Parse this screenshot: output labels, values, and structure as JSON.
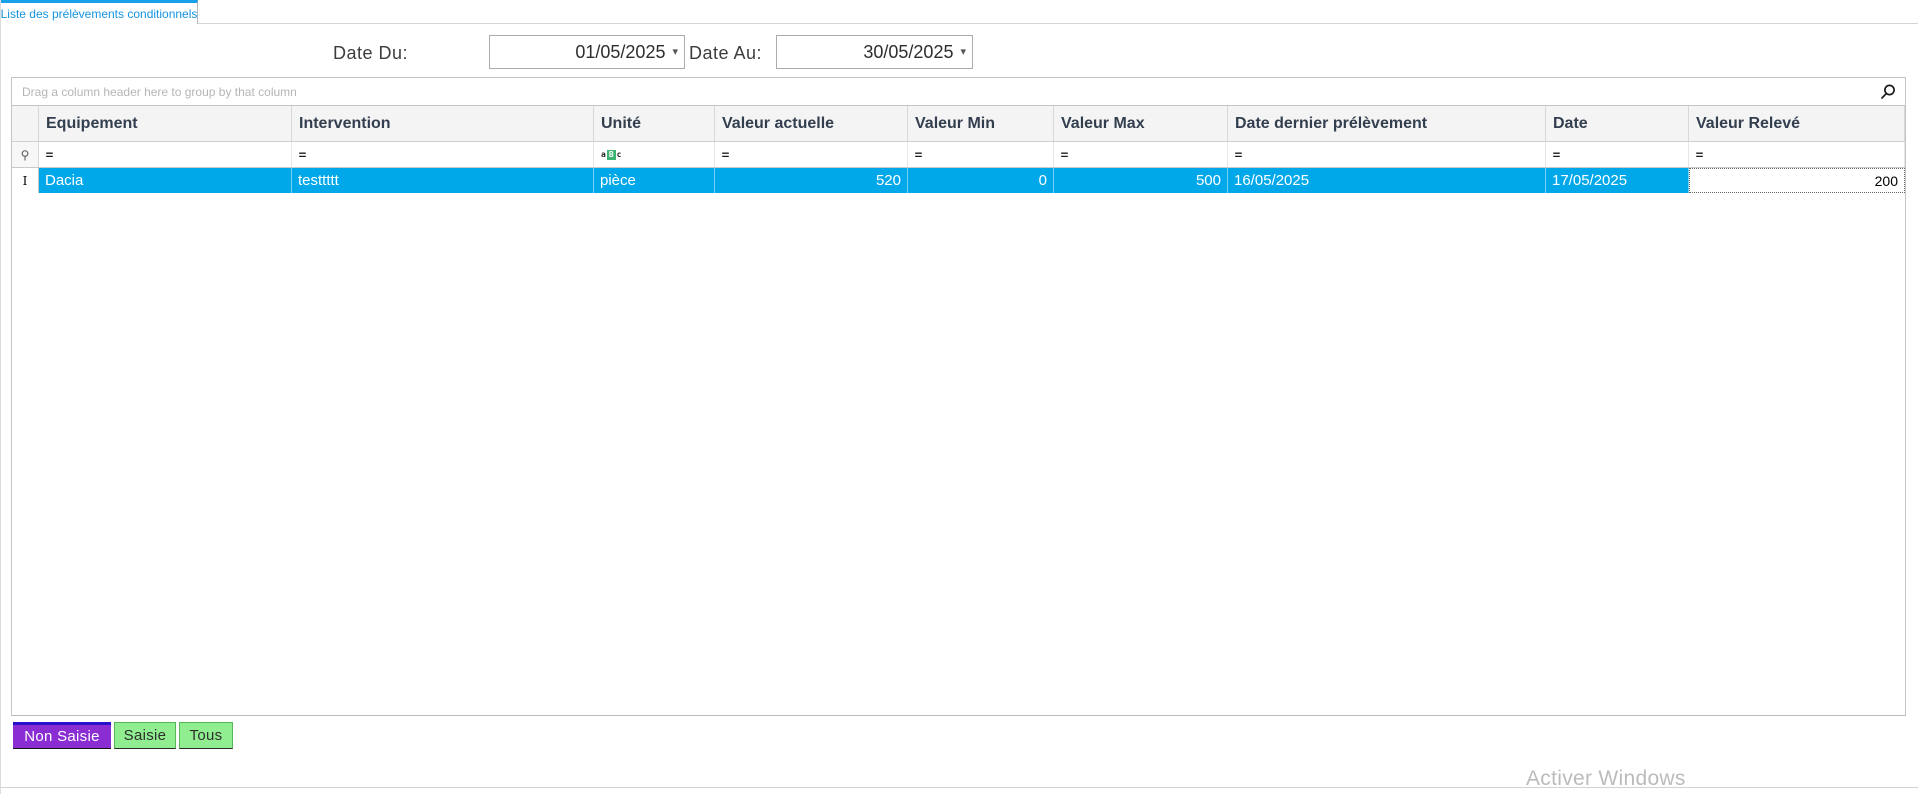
{
  "tab": {
    "label": "Liste des prélèvements conditionnels"
  },
  "date_filter": {
    "from_label": "Date Du:",
    "from_value": "01/05/2025",
    "to_label": "Date Au:",
    "to_value": "30/05/2025"
  },
  "grid": {
    "group_panel_text": "Drag a column header here to group by that column",
    "columns": [
      {
        "label": "Equipement"
      },
      {
        "label": "Intervention"
      },
      {
        "label": "Unité"
      },
      {
        "label": "Valeur actuelle"
      },
      {
        "label": "Valeur Min"
      },
      {
        "label": "Valeur Max"
      },
      {
        "label": "Date dernier prélèvement"
      },
      {
        "label": "Date"
      },
      {
        "label": "Valeur Relevé"
      }
    ],
    "rows": [
      {
        "equipement": "Dacia",
        "intervention": "testtttt",
        "unite": "pièce",
        "valeur_actuelle": "520",
        "valeur_min": "0",
        "valeur_max": "500",
        "date_dernier_prelevement": "16/05/2025",
        "date": "17/05/2025",
        "valeur_releve": "200"
      }
    ]
  },
  "icons": {
    "equals_glyph": "=",
    "pin_glyph": "⚲",
    "row_focus_glyph": "I",
    "abc_a": "a",
    "abc_b": "B",
    "abc_c": "c",
    "dropdown_glyph": "▾"
  },
  "footer": {
    "buttons": [
      {
        "label": "Non Saisie"
      },
      {
        "label": "Saisie"
      },
      {
        "label": "Tous"
      }
    ]
  },
  "watermark": {
    "line1": "Activer Windows"
  },
  "colors": {
    "accent_blue": "#18a0e8",
    "selected_row_blue": "#00a8ea",
    "button_purple": "#8a2dd2",
    "button_green": "#90ee90",
    "focus_navy": "#2812cc",
    "abc_icon_green": "#3cb371"
  }
}
